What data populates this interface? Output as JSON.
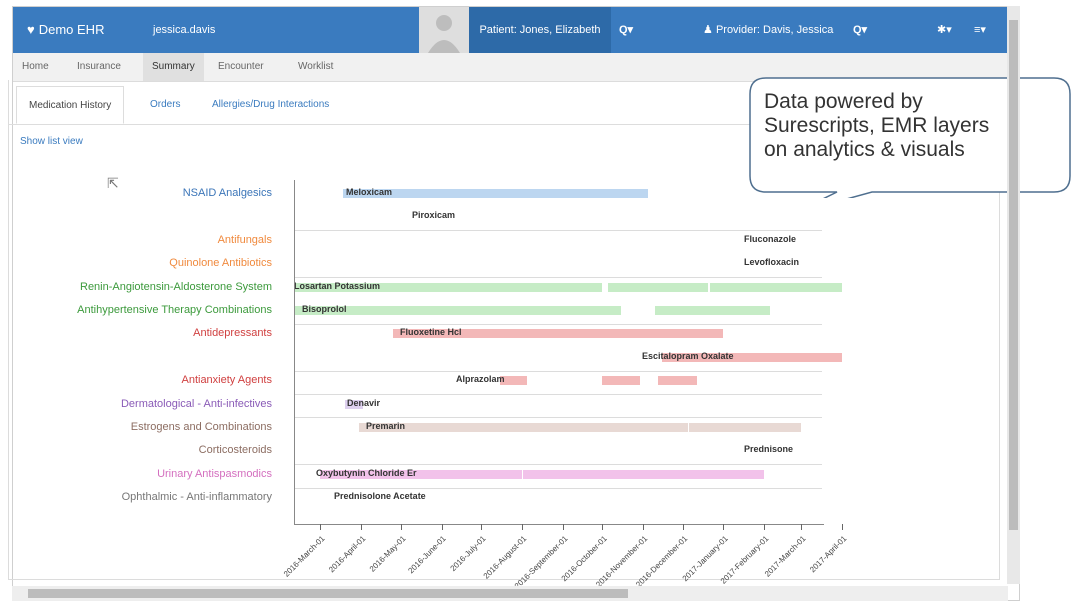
{
  "navbar": {
    "brand": "Demo EHR",
    "user": "jessica.davis",
    "patient": "Patient: Jones, Elizabeth",
    "patient_search": "Q▾",
    "provider": "Provider: Davis, Jessica",
    "provider_search": "Q▾",
    "settings": "✱▾",
    "menu": "≡▾"
  },
  "tabs": [
    {
      "label": "Home"
    },
    {
      "label": "Insurance"
    },
    {
      "label": "Summary"
    },
    {
      "label": "Encounter"
    },
    {
      "label": "Worklist"
    }
  ],
  "subtabs": [
    {
      "label": "Medication History"
    },
    {
      "label": "Orders"
    },
    {
      "label": "Allergies/Drug Interactions"
    }
  ],
  "show_list_view": "Show list view",
  "callout": "Data powered by\nSurescripts, EMR layers\non analytics & visuals",
  "colors": {
    "navbar": "#3a7bbf",
    "nsaid": "#3b75b8",
    "orange": "#f08a3e",
    "green": "#3c9a3c",
    "red": "#d04040",
    "purple": "#8a5bb7",
    "brown": "#8c6d62",
    "pink": "#d46fbf",
    "gray": "#777777"
  },
  "chart_data": {
    "type": "timeline",
    "x_ticks": [
      "2016-March-01",
      "2016-April-01",
      "2016-May-01",
      "2016-June-01",
      "2016-July-01",
      "2016-August-01",
      "2016-September-01",
      "2016-October-01",
      "2016-November-01",
      "2016-December-01",
      "2017-January-01",
      "2017-February-01",
      "2017-March-01",
      "2017-April-01"
    ],
    "categories": [
      {
        "label": "NSAID Analgesics",
        "color": "#3b75b8"
      },
      {
        "label": "Antifungals",
        "color": "#f08a3e"
      },
      {
        "label": "Quinolone Antibiotics",
        "color": "#f08a3e"
      },
      {
        "label": "Renin-Angiotensin-Aldosterone System",
        "color": "#3c9a3c"
      },
      {
        "label": "Antihypertensive Therapy Combinations",
        "color": "#3c9a3c"
      },
      {
        "label": "Antidepressants",
        "color": "#d04040"
      },
      {
        "label": "Antianxiety Agents",
        "color": "#d04040"
      },
      {
        "label": "Dermatological - Anti-infectives",
        "color": "#8a5bb7"
      },
      {
        "label": "Estrogens and Combinations",
        "color": "#8c6d62"
      },
      {
        "label": "Corticosteroids",
        "color": "#8c6d62"
      },
      {
        "label": "Urinary Antispasmodics",
        "color": "#d46fbf"
      },
      {
        "label": "Ophthalmic - Anti-inflammatory",
        "color": "#777777"
      }
    ],
    "drugs": [
      {
        "name": "Meloxicam",
        "category": "NSAID Analgesics",
        "color": "#bcd6f0",
        "periods": [
          [
            "2016-03-18",
            "2016-11-05"
          ]
        ]
      },
      {
        "name": "Piroxicam",
        "category": "NSAID Analgesics",
        "color": "#bcd6f0",
        "periods": []
      },
      {
        "name": "Fluconazole",
        "category": "Antifungals",
        "color": "#f7c9a4",
        "periods": []
      },
      {
        "name": "Levofloxacin",
        "category": "Quinolone Antibiotics",
        "color": "#f7c9a4",
        "periods": []
      },
      {
        "name": "Losartan Potassium",
        "category": "Renin-Angiotensin-Aldosterone System",
        "color": "#c6ecc6",
        "periods": [
          [
            "2016-02-10",
            "2016-10-01"
          ],
          [
            "2016-10-05",
            "2016-12-20"
          ],
          [
            "2016-12-22",
            "2017-04-01"
          ]
        ]
      },
      {
        "name": "Bisoprolol",
        "category": "Antihypertensive Therapy Combinations",
        "color": "#c6ecc6",
        "periods": [
          [
            "2016-02-10",
            "2016-10-15"
          ],
          [
            "2016-11-10",
            "2017-02-05"
          ]
        ]
      },
      {
        "name": "Fluoxetine Hcl",
        "category": "Antidepressants",
        "color": "#f3b8b8",
        "periods": [
          [
            "2016-04-25",
            "2017-01-01"
          ]
        ]
      },
      {
        "name": "Escitalopram Oxalate",
        "category": "Antidepressants",
        "color": "#f3b8b8",
        "periods": [
          [
            "2016-11-15",
            "2017-04-01"
          ]
        ]
      },
      {
        "name": "Alprazolam",
        "category": "Antianxiety Agents",
        "color": "#f3b8b8",
        "periods": [
          [
            "2016-07-15",
            "2016-08-05"
          ],
          [
            "2016-10-01",
            "2016-10-30"
          ],
          [
            "2016-11-12",
            "2016-12-12"
          ]
        ]
      },
      {
        "name": "Denavir",
        "category": "Dermatological - Anti-infectives",
        "color": "#ddd0ee",
        "periods": [
          [
            "2016-03-20",
            "2016-04-02"
          ]
        ]
      },
      {
        "name": "Premarin",
        "category": "Estrogens and Combinations",
        "color": "#e8d9d4",
        "periods": [
          [
            "2016-03-30",
            "2016-12-05"
          ],
          [
            "2016-12-06",
            "2017-03-01"
          ]
        ]
      },
      {
        "name": "Prednisone",
        "category": "Corticosteroids",
        "color": "#e8d9d4",
        "periods": []
      },
      {
        "name": "Oxybutynin Chloride Er",
        "category": "Urinary Antispasmodics",
        "color": "#f2c2ea",
        "periods": [
          [
            "2016-03-01",
            "2016-08-01"
          ],
          [
            "2016-08-02",
            "2017-02-01"
          ]
        ]
      },
      {
        "name": "Prednisolone Acetate",
        "category": "Ophthalmic - Anti-inflammatory",
        "color": "#dddddd",
        "periods": []
      }
    ]
  }
}
